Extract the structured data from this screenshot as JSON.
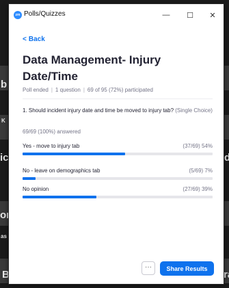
{
  "window": {
    "title": "Polls/Quizzes",
    "app_icon_text": "zm",
    "minimize_glyph": "—",
    "maximize_glyph": "☐",
    "close_glyph": "✕"
  },
  "nav": {
    "back_chevron": "<",
    "back_label": "Back"
  },
  "poll": {
    "title": "Data Management- Injury Date/Time",
    "status": "Poll ended",
    "question_count": "1 question",
    "participation": "69 of 95 (72%) participated"
  },
  "question": {
    "text": "1. Should incident injury date and time be moved to injury tab?",
    "type": "(Single Choice)",
    "answered": "69/69 (100%) answered",
    "options": [
      {
        "label": "Yes - move to injury tab",
        "stat": "(37/69) 54%",
        "percent": 54
      },
      {
        "label": "No - leave on demographics tab",
        "stat": "(5/69) 7%",
        "percent": 7
      },
      {
        "label": "No opinion",
        "stat": "(27/69) 39%",
        "percent": 39
      }
    ]
  },
  "footer": {
    "more_label": "···",
    "share_label": "Share Results"
  },
  "colors": {
    "accent": "#0e72ed",
    "track": "#e6e6ea",
    "text": "#232333",
    "muted": "#747487"
  },
  "background": {
    "glyphs": [
      "b",
      "K",
      "ic",
      "d",
      "or",
      "as",
      "ra",
      "B"
    ]
  }
}
